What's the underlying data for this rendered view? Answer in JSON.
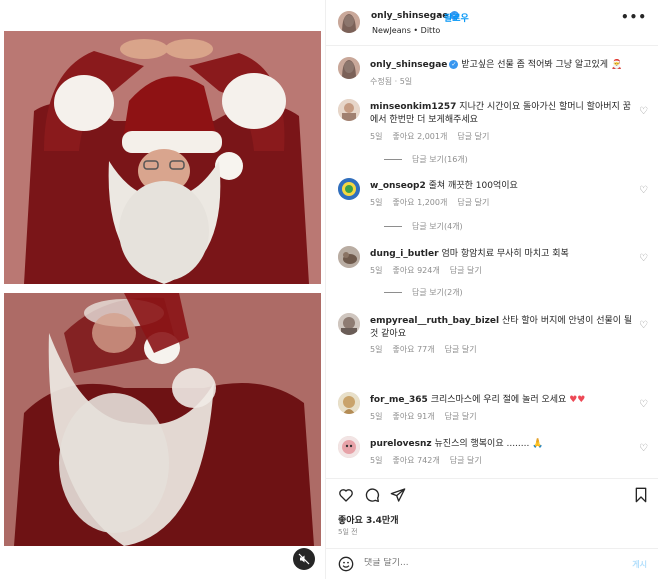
{
  "post": {
    "username": "only_shinsegae",
    "follow_label": "팔로우",
    "dot": "•",
    "subtitle": "NewJeans • Ditto",
    "more_label": "•••",
    "caption_text": "받고싶은 선물 좀 적어봐 그냥 알고있게",
    "caption_meta": "수정됨 · 5일"
  },
  "comments": [
    {
      "username": "minseonkim1257",
      "text": "지나간 시간이요 돌아가신 할머니 할아버지 꿈에서 한번만 더 보게해주세요",
      "age": "5일",
      "likes": "좋아요 2,001개",
      "reply": "답글 달기",
      "replies": "답글 보기(16개)"
    },
    {
      "username": "w_onseop2",
      "text": "줄쳐 깨끗한 100억이요",
      "age": "5일",
      "likes": "좋아요 1,200개",
      "reply": "답글 달기",
      "replies": "답글 보기(4개)"
    },
    {
      "username": "dung_i_butler",
      "text": "엄마 항암치료 무사히 마치고 회복",
      "age": "5일",
      "likes": "좋아요 924개",
      "reply": "답글 달기",
      "replies": "답글 보기(2개)"
    },
    {
      "username": "empyreal__ruth_bay_bizel",
      "text": "산타 할아 버지에 안녕이 선물이 될 것 같아요",
      "age": "5일",
      "likes": "좋아요 77개",
      "reply": "답글 달기",
      "replies": ""
    },
    {
      "username": "for_me_365",
      "text": "크리스마스에 우리 절에 놀러 오세요",
      "age": "5일",
      "likes": "좋아요 91개",
      "reply": "답글 달기",
      "replies": ""
    },
    {
      "username": "purelovesnz",
      "text": "뉴진스의 행복이요 ........",
      "age": "5일",
      "likes": "좋아요 742개",
      "reply": "답글 달기",
      "replies": ""
    }
  ],
  "footer": {
    "likes": "좋아요 3.4만개",
    "date": "5일 전",
    "comment_placeholder": "댓글 달기...",
    "post_label": "게시"
  },
  "colors": {
    "link": "#0095f6",
    "verified": "#3897f0",
    "heart": "#ed4956"
  }
}
